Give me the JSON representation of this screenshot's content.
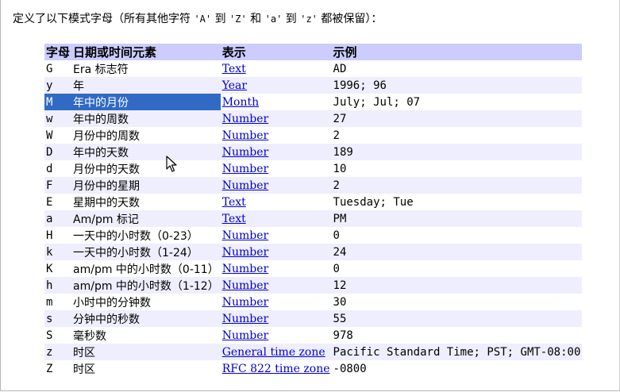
{
  "intro": {
    "prefix": "定义了以下模式字母（所有其他字符 ",
    "q1": "'A'",
    "to1": " 到 ",
    "q2": "'Z'",
    "and": " 和 ",
    "q3": "'a'",
    "to2": " 到 ",
    "q4": "'z'",
    "suffix": " 都被保留）："
  },
  "table": {
    "headers": [
      "字母",
      "日期或时间元素",
      "表示",
      "示例"
    ],
    "rows": [
      {
        "letter": "G",
        "element": "Era 标志符",
        "presentation": "Text",
        "example": "AD"
      },
      {
        "letter": "y",
        "element": "年",
        "presentation": "Year",
        "example": "1996; 96"
      },
      {
        "letter": "M",
        "element": "年中的月份",
        "presentation": "Month",
        "example": "July; Jul; 07"
      },
      {
        "letter": "w",
        "element": "年中的周数",
        "presentation": "Number",
        "example": "27"
      },
      {
        "letter": "W",
        "element": "月份中的周数",
        "presentation": "Number",
        "example": "2"
      },
      {
        "letter": "D",
        "element": "年中的天数",
        "presentation": "Number",
        "example": "189"
      },
      {
        "letter": "d",
        "element": "月份中的天数",
        "presentation": "Number",
        "example": "10"
      },
      {
        "letter": "F",
        "element": "月份中的星期",
        "presentation": "Number",
        "example": "2"
      },
      {
        "letter": "E",
        "element": "星期中的天数",
        "presentation": "Text",
        "example": "Tuesday; Tue"
      },
      {
        "letter": "a",
        "element": "Am/pm 标记",
        "presentation": "Text",
        "example": "PM"
      },
      {
        "letter": "H",
        "element": "一天中的小时数（0-23）",
        "presentation": "Number",
        "example": "0"
      },
      {
        "letter": "k",
        "element": "一天中的小时数（1-24）",
        "presentation": "Number",
        "example": "24"
      },
      {
        "letter": "K",
        "element": "am/pm 中的小时数（0-11）",
        "presentation": "Number",
        "example": "0"
      },
      {
        "letter": "h",
        "element": "am/pm 中的小时数（1-12）",
        "presentation": "Number",
        "example": "12"
      },
      {
        "letter": "m",
        "element": "小时中的分钟数",
        "presentation": "Number",
        "example": "30"
      },
      {
        "letter": "s",
        "element": "分钟中的秒数",
        "presentation": "Number",
        "example": "55"
      },
      {
        "letter": "S",
        "element": "毫秒数",
        "presentation": "Number",
        "example": "978"
      },
      {
        "letter": "z",
        "element": "时区",
        "presentation": "General time zone",
        "example": "Pacific Standard Time; PST; GMT-08:00"
      },
      {
        "letter": "Z",
        "element": "时区",
        "presentation": "RFC 822 time zone",
        "example": "-0800"
      }
    ]
  },
  "selection": {
    "selected_row_letter": "M",
    "highlight_color": "#316ac5"
  },
  "colors": {
    "header_bg": "#ccccff",
    "alt_row_bg": "#eeeeff",
    "link": "#0000cc"
  },
  "cursor": {
    "icon": "arrow-cursor-icon"
  }
}
